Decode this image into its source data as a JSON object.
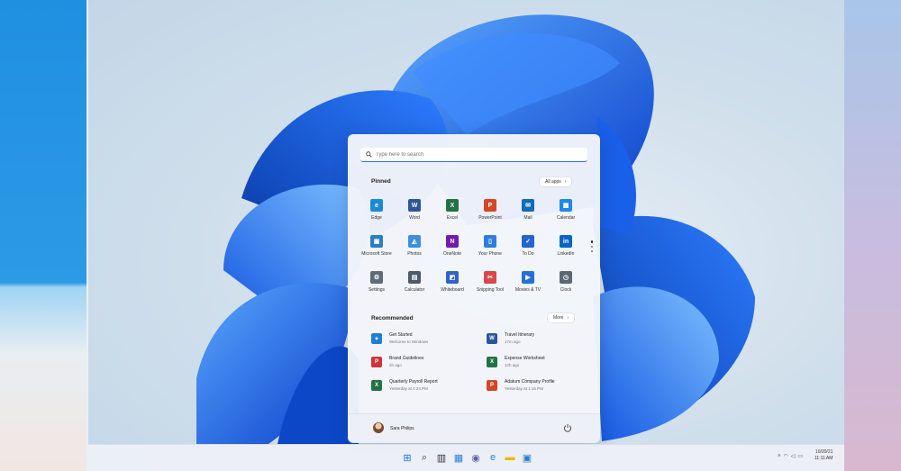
{
  "search": {
    "placeholder": "Type here to search"
  },
  "pinned": {
    "title": "Pinned",
    "all_apps_label": "All apps",
    "apps": [
      {
        "label": "Edge",
        "icon": "edge-icon",
        "color": "#1b8ad6"
      },
      {
        "label": "Word",
        "icon": "word-icon",
        "color": "#2b579a"
      },
      {
        "label": "Excel",
        "icon": "excel-icon",
        "color": "#217346"
      },
      {
        "label": "PowerPoint",
        "icon": "powerpoint-icon",
        "color": "#d24726"
      },
      {
        "label": "Mail",
        "icon": "mail-icon",
        "color": "#0f6cbd"
      },
      {
        "label": "Calendar",
        "icon": "calendar-icon",
        "color": "#1e88e5"
      },
      {
        "label": "Microsoft Store",
        "icon": "store-icon",
        "color": "#2a7fc4"
      },
      {
        "label": "Photos",
        "icon": "photos-icon",
        "color": "#3b8ee0"
      },
      {
        "label": "OneNote",
        "icon": "onenote-icon",
        "color": "#7719aa"
      },
      {
        "label": "Your Phone",
        "icon": "phone-icon",
        "color": "#2d7de0"
      },
      {
        "label": "To Do",
        "icon": "todo-icon",
        "color": "#2564cf"
      },
      {
        "label": "LinkedIn",
        "icon": "linkedin-icon",
        "color": "#0a66c2"
      },
      {
        "label": "Settings",
        "icon": "settings-icon",
        "color": "#5d6b7b"
      },
      {
        "label": "Calculator",
        "icon": "calculator-icon",
        "color": "#4a5a6a"
      },
      {
        "label": "Whiteboard",
        "icon": "whiteboard-icon",
        "color": "#3063c9"
      },
      {
        "label": "Snipping Tool",
        "icon": "snipping-icon",
        "color": "#d84848"
      },
      {
        "label": "Movies & TV",
        "icon": "movies-icon",
        "color": "#2570d6"
      },
      {
        "label": "Clock",
        "icon": "clock-icon",
        "color": "#5b6773"
      }
    ]
  },
  "recommended": {
    "title": "Recommended",
    "more_label": "More",
    "items": [
      {
        "title": "Get Started",
        "subtitle": "Welcome to Windows",
        "icon": "get-started-icon",
        "color": "#1e7fd0"
      },
      {
        "title": "Travel Itinerary",
        "subtitle": "17m ago",
        "icon": "word-doc-icon",
        "color": "#2b579a"
      },
      {
        "title": "Brand Guidelines",
        "subtitle": "2h ago",
        "icon": "pdf-icon",
        "color": "#d13438"
      },
      {
        "title": "Expense Worksheet",
        "subtitle": "12h ago",
        "icon": "excel-doc-icon",
        "color": "#217346"
      },
      {
        "title": "Quarterly Payroll Report",
        "subtitle": "Yesterday at 4:24 PM",
        "icon": "excel-doc-icon",
        "color": "#217346"
      },
      {
        "title": "Adatum Company Profile",
        "subtitle": "Yesterday at 1:15 PM",
        "icon": "powerpoint-doc-icon",
        "color": "#d24726"
      }
    ]
  },
  "user": {
    "name": "Sara Philips"
  },
  "taskbar": {
    "icons": [
      "windows-start-icon",
      "search-icon",
      "task-view-icon",
      "widgets-icon",
      "chat-icon",
      "edge-icon",
      "file-explorer-icon",
      "store-icon"
    ],
    "time": "10/20/21",
    "date": "11:11 AM"
  }
}
